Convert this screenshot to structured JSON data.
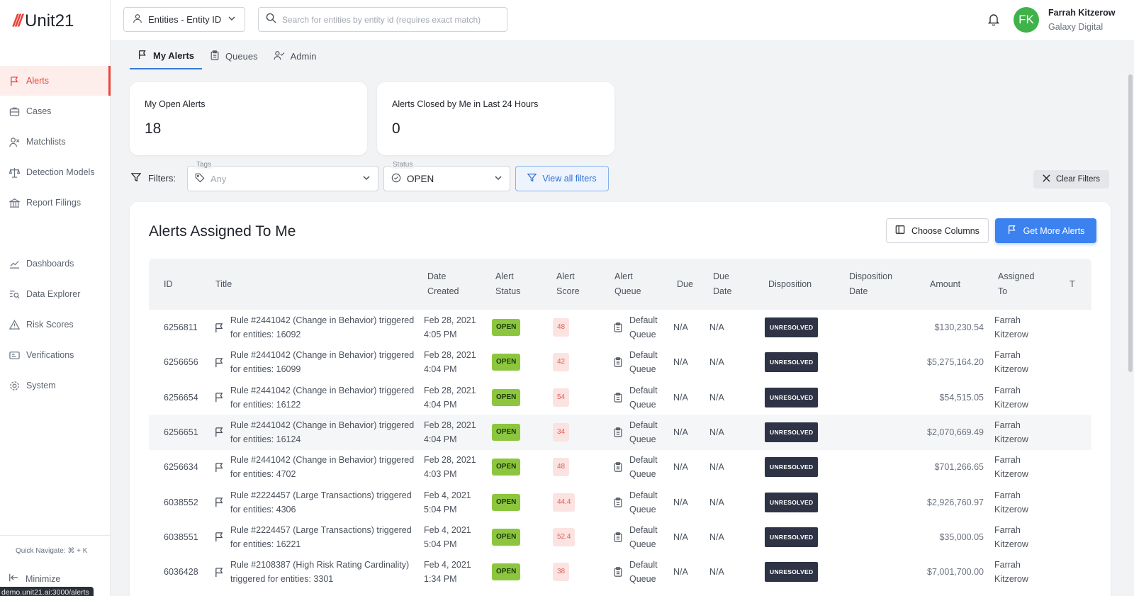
{
  "app": {
    "logo_slashes": "///",
    "logo_name": "Unit21",
    "url_status": "demo.unit21.ai:3000/alerts"
  },
  "sidebar": {
    "items": [
      {
        "label": "Alerts",
        "icon": "flag-icon"
      },
      {
        "label": "Cases",
        "icon": "briefcase-icon"
      },
      {
        "label": "Matchlists",
        "icon": "user-x-icon"
      },
      {
        "label": "Detection Models",
        "icon": "scale-icon"
      },
      {
        "label": "Report Filings",
        "icon": "bank-icon"
      },
      {
        "label": "Dashboards",
        "icon": "chart-line-icon"
      },
      {
        "label": "Data Explorer",
        "icon": "zoom-list-icon"
      },
      {
        "label": "Risk Scores",
        "icon": "warning-icon"
      },
      {
        "label": "Verifications",
        "icon": "id-card-icon"
      },
      {
        "label": "System",
        "icon": "gear-icon"
      }
    ],
    "quick_navigate": "Quick Navigate: ⌘ + K",
    "minimize": "Minimize"
  },
  "topbar": {
    "entity_select": "Entities - Entity ID",
    "search_placeholder": "Search for entities by entity id (requires exact match)",
    "user": {
      "initials": "FK",
      "name": "Farrah Kitzerow",
      "org": "Galaxy Digital",
      "avatar_color": "#3fb24a"
    }
  },
  "tabs": [
    {
      "label": "My Alerts"
    },
    {
      "label": "Queues"
    },
    {
      "label": "Admin"
    }
  ],
  "stats": {
    "open": {
      "label": "My Open Alerts",
      "value": "18"
    },
    "closed": {
      "label": "Alerts Closed by Me in Last 24 Hours",
      "value": "0"
    }
  },
  "filters": {
    "label": "Filters:",
    "tags_legend": "Tags",
    "tags_value": "Any",
    "status_legend": "Status",
    "status_value": "OPEN",
    "view_all": "View all filters",
    "clear": "Clear Filters"
  },
  "main": {
    "title": "Alerts Assigned To Me",
    "choose_columns": "Choose Columns",
    "get_more": "Get More Alerts",
    "accent": "#3b82f0"
  },
  "table": {
    "headers": {
      "id": "ID",
      "title": "Title",
      "date1": "Date",
      "date2": "Created",
      "status1": "Alert",
      "status2": "Status",
      "score1": "Alert",
      "score2": "Score",
      "queue1": "Alert",
      "queue2": "Queue",
      "due": "Due",
      "duedate1": "Due",
      "duedate2": "Date",
      "disposition": "Disposition",
      "dispdate1": "Disposition",
      "dispdate2": "Date",
      "amount": "Amount",
      "assigned1": "Assigned",
      "assigned2": "To",
      "extra": "T"
    },
    "rows": [
      {
        "id": "6256811",
        "title1": "Rule #2441042 (Change in Behavior) triggered",
        "title2": "for entities: 16092",
        "date1": "Feb 28, 2021",
        "date2": "4:05 PM",
        "status": "OPEN",
        "score": "48",
        "queue1": "Default",
        "queue2": "Queue",
        "due": "N/A",
        "due_date": "N/A",
        "disposition": "UNRESOLVED",
        "amount": "$130,230.54",
        "assigned1": "Farrah",
        "assigned2": "Kitzerow"
      },
      {
        "id": "6256656",
        "title1": "Rule #2441042 (Change in Behavior) triggered",
        "title2": "for entities: 16099",
        "date1": "Feb 28, 2021",
        "date2": "4:04 PM",
        "status": "OPEN",
        "score": "42",
        "queue1": "Default",
        "queue2": "Queue",
        "due": "N/A",
        "due_date": "N/A",
        "disposition": "UNRESOLVED",
        "amount": "$5,275,164.20",
        "assigned1": "Farrah",
        "assigned2": "Kitzerow"
      },
      {
        "id": "6256654",
        "title1": "Rule #2441042 (Change in Behavior) triggered",
        "title2": "for entities: 16122",
        "date1": "Feb 28, 2021",
        "date2": "4:04 PM",
        "status": "OPEN",
        "score": "54",
        "queue1": "Default",
        "queue2": "Queue",
        "due": "N/A",
        "due_date": "N/A",
        "disposition": "UNRESOLVED",
        "amount": "$54,515.05",
        "assigned1": "Farrah",
        "assigned2": "Kitzerow"
      },
      {
        "id": "6256651",
        "title1": "Rule #2441042 (Change in Behavior) triggered",
        "title2": "for entities: 16124",
        "date1": "Feb 28, 2021",
        "date2": "4:04 PM",
        "status": "OPEN",
        "score": "34",
        "queue1": "Default",
        "queue2": "Queue",
        "due": "N/A",
        "due_date": "N/A",
        "disposition": "UNRESOLVED",
        "amount": "$2,070,669.49",
        "assigned1": "Farrah",
        "assigned2": "Kitzerow"
      },
      {
        "id": "6256634",
        "title1": "Rule #2441042 (Change in Behavior) triggered",
        "title2": "for entities: 4702",
        "date1": "Feb 28, 2021",
        "date2": "4:03 PM",
        "status": "OPEN",
        "score": "48",
        "queue1": "Default",
        "queue2": "Queue",
        "due": "N/A",
        "due_date": "N/A",
        "disposition": "UNRESOLVED",
        "amount": "$701,266.65",
        "assigned1": "Farrah",
        "assigned2": "Kitzerow"
      },
      {
        "id": "6038552",
        "title1": "Rule #2224457 (Large Transactions) triggered",
        "title2": "for entities: 4306",
        "date1": "Feb 4, 2021",
        "date2": "5:04 PM",
        "status": "OPEN",
        "score": "44.4",
        "queue1": "Default",
        "queue2": "Queue",
        "due": "N/A",
        "due_date": "N/A",
        "disposition": "UNRESOLVED",
        "amount": "$2,926,760.97",
        "assigned1": "Farrah",
        "assigned2": "Kitzerow"
      },
      {
        "id": "6038551",
        "title1": "Rule #2224457 (Large Transactions) triggered",
        "title2": "for entities: 16221",
        "date1": "Feb 4, 2021",
        "date2": "5:04 PM",
        "status": "OPEN",
        "score": "52.4",
        "queue1": "Default",
        "queue2": "Queue",
        "due": "N/A",
        "due_date": "N/A",
        "disposition": "UNRESOLVED",
        "amount": "$35,000.05",
        "assigned1": "Farrah",
        "assigned2": "Kitzerow"
      },
      {
        "id": "6036428",
        "title1": "Rule #2108387 (High Risk Rating Cardinality)",
        "title2": "triggered for entities: 3301",
        "date1": "Feb 4, 2021",
        "date2": "1:34 PM",
        "status": "OPEN",
        "score": "38",
        "queue1": "Default",
        "queue2": "Queue",
        "due": "N/A",
        "due_date": "N/A",
        "disposition": "UNRESOLVED",
        "amount": "$7,001,700.00",
        "assigned1": "Farrah",
        "assigned2": "Kitzerow"
      }
    ]
  }
}
